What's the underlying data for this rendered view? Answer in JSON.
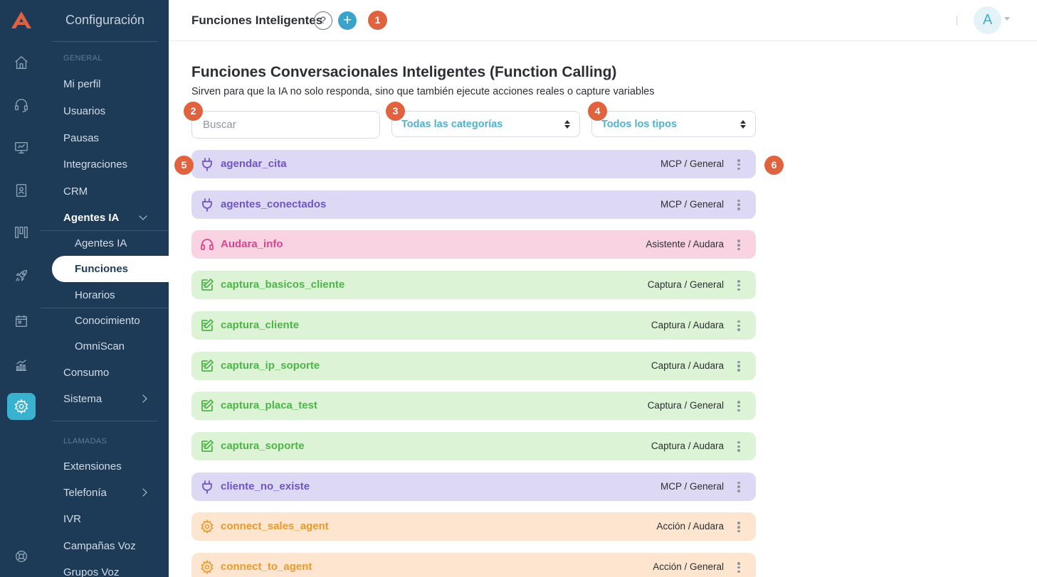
{
  "app": {
    "menu_title": "Configuración",
    "sections": {
      "general": "GENERAL",
      "llamadas": "LLAMADAS"
    },
    "menu_items": {
      "mi_perfil": "Mi perfil",
      "usuarios": "Usuarios",
      "pausas": "Pausas",
      "integraciones": "Integraciones",
      "crm": "CRM",
      "agentes_ia": "Agentes IA",
      "consumo": "Consumo",
      "sistema": "Sistema",
      "extensiones": "Extensiones",
      "telefonia": "Telefonía",
      "ivr": "IVR",
      "campanas_voz": "Campañas Voz",
      "grupos_voz": "Grupos Voz"
    },
    "submenu_items": {
      "agentes_ia": "Agentes IA",
      "funciones": "Funciones",
      "horarios": "Horarios",
      "conocimiento": "Conocimiento",
      "omniscan": "OmniScan"
    }
  },
  "header": {
    "title": "Funciones Inteligentes",
    "help": "?",
    "add": "+",
    "avatar": "A"
  },
  "badges": {
    "b1": "1",
    "b2": "2",
    "b3": "3",
    "b4": "4",
    "b5": "5",
    "b6": "6"
  },
  "page": {
    "title": "Funciones Conversacionales Inteligentes (Function Calling)",
    "subtitle": "Sirven para que la IA no solo responda, sino que también ejecute acciones reales o capture variables"
  },
  "filters": {
    "search_placeholder": "Buscar",
    "category": "Todas las categorías",
    "type": "Todos los tipos"
  },
  "functions": [
    {
      "name": "agendar_cita",
      "type": "MCP / General",
      "icon": "plug-icon",
      "color": "#6f55c5"
    },
    {
      "name": "agentes_conectados",
      "type": "MCP / General",
      "icon": "plug-icon",
      "color": "#6f55c5"
    },
    {
      "name": "Audara_info",
      "type": "Asistente / Audara",
      "icon": "headset-icon",
      "color": "#d9458c"
    },
    {
      "name": "captura_basicos_cliente",
      "type": "Captura / General",
      "icon": "capture-edit-icon",
      "color": "#4eb548"
    },
    {
      "name": "captura_cliente",
      "type": "Captura / Audara",
      "icon": "capture-edit-icon",
      "color": "#4eb548"
    },
    {
      "name": "captura_ip_soporte",
      "type": "Captura / Audara",
      "icon": "capture-edit-icon",
      "color": "#4eb548"
    },
    {
      "name": "captura_placa_test",
      "type": "Captura / General",
      "icon": "capture-edit-icon",
      "color": "#4eb548"
    },
    {
      "name": "captura_soporte",
      "type": "Captura / Audara",
      "icon": "capture-edit-icon",
      "color": "#4eb548"
    },
    {
      "name": "cliente_no_existe",
      "type": "MCP / General",
      "icon": "plug-icon",
      "color": "#6f55c5"
    },
    {
      "name": "connect_sales_agent",
      "type": "Acción / Audara",
      "icon": "gear-icon",
      "color": "#ea9a2c"
    },
    {
      "name": "connect_to_agent",
      "type": "Acción / General",
      "icon": "gear-icon",
      "color": "#ea9a2c"
    }
  ]
}
